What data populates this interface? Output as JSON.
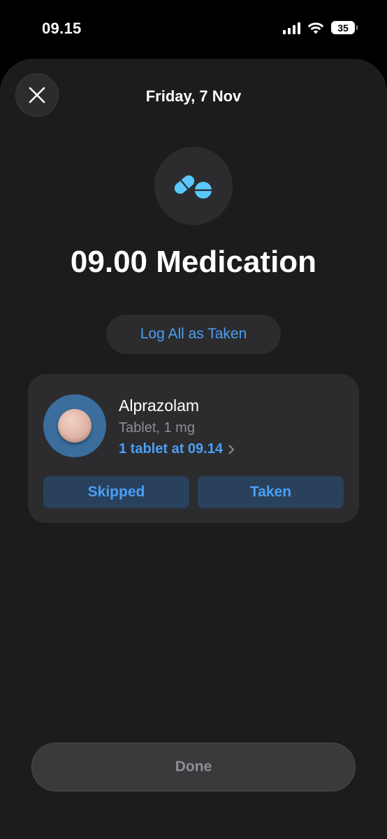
{
  "status_bar": {
    "time": "09.15",
    "battery": "35"
  },
  "header": {
    "date": "Friday, 7 Nov"
  },
  "icons": {
    "close": "close-icon",
    "header": "pills-icon",
    "chevron": "chevron-right-icon"
  },
  "title": "09.00 Medication",
  "log_all_label": "Log All as Taken",
  "medication": {
    "name": "Alprazolam",
    "detail": "Tablet, 1 mg",
    "log_status": "1 tablet at 09.14",
    "skipped_label": "Skipped",
    "taken_label": "Taken"
  },
  "done_label": "Done",
  "colors": {
    "accent": "#4a9ff5",
    "sheet_background": "#1c1c1e",
    "card_background": "#2c2c2e",
    "button_background": "#29415c",
    "icon_blue": "#5ac8fa",
    "tablet": "#e0b3a3"
  }
}
